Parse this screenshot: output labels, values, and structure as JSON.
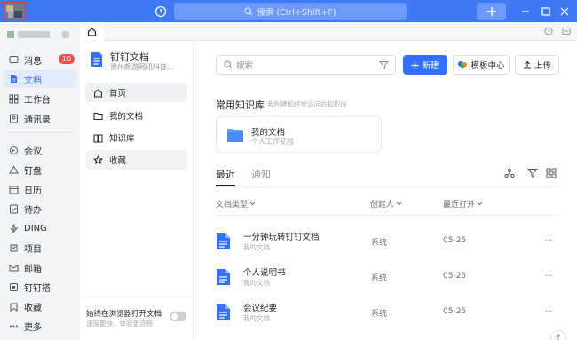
{
  "titlebar": {
    "search_placeholder": "搜索 (Ctrl+Shift+F)",
    "accent": "#3d78f5"
  },
  "left_nav": {
    "items": [
      {
        "label": "消息",
        "icon": "message-icon",
        "badge": "10"
      },
      {
        "label": "文档",
        "icon": "document-icon",
        "active": true
      },
      {
        "label": "工作台",
        "icon": "workbench-icon"
      },
      {
        "label": "通讯录",
        "icon": "contacts-icon"
      },
      {
        "label": "会议",
        "icon": "meeting-icon"
      },
      {
        "label": "钉盘",
        "icon": "drive-icon"
      },
      {
        "label": "日历",
        "icon": "calendar-icon"
      },
      {
        "label": "待办",
        "icon": "todo-icon"
      },
      {
        "label": "DING",
        "icon": "ding-icon"
      },
      {
        "label": "项目",
        "icon": "project-icon"
      },
      {
        "label": "邮箱",
        "icon": "mail-icon"
      },
      {
        "label": "钉钉搭",
        "icon": "builder-icon"
      },
      {
        "label": "收藏",
        "icon": "favorites-icon"
      },
      {
        "label": "更多",
        "icon": "more-icon"
      }
    ]
  },
  "doc_sidebar": {
    "title": "钉钉文档",
    "subtitle": "贵州颜游网讯科技...",
    "items": [
      {
        "label": "首页",
        "icon": "home-icon"
      },
      {
        "label": "我的文档",
        "icon": "folder-icon"
      },
      {
        "label": "知识库",
        "icon": "book-icon"
      },
      {
        "label": "收藏",
        "icon": "star-icon"
      }
    ],
    "footer_title": "始终在浏览器打开文档",
    "footer_sub": "速度更快，体验更流畅"
  },
  "main": {
    "search_placeholder": "搜索",
    "new_label": "新建",
    "template_label": "模板中心",
    "upload_label": "上传",
    "kb_title": "常用知识库",
    "kb_hint": "我创建和经常访问的知识库",
    "kb_card_name": "我的文档",
    "kb_card_sub": "个人工作文档",
    "tab_recent": "最近",
    "tab_notify": "通知",
    "col_type": "文档类型",
    "col_creator": "创建人",
    "col_opened": "最近打开",
    "rows": [
      {
        "name": "一分钟玩转钉钉文档",
        "location": "我的文档",
        "creator": "系统",
        "date": "05-25"
      },
      {
        "name": "个人说明书",
        "location": "我的文档",
        "creator": "系统",
        "date": "05-25"
      },
      {
        "name": "会议纪要",
        "location": "我的文档",
        "creator": "系统",
        "date": "05-25"
      }
    ],
    "more": "···"
  }
}
